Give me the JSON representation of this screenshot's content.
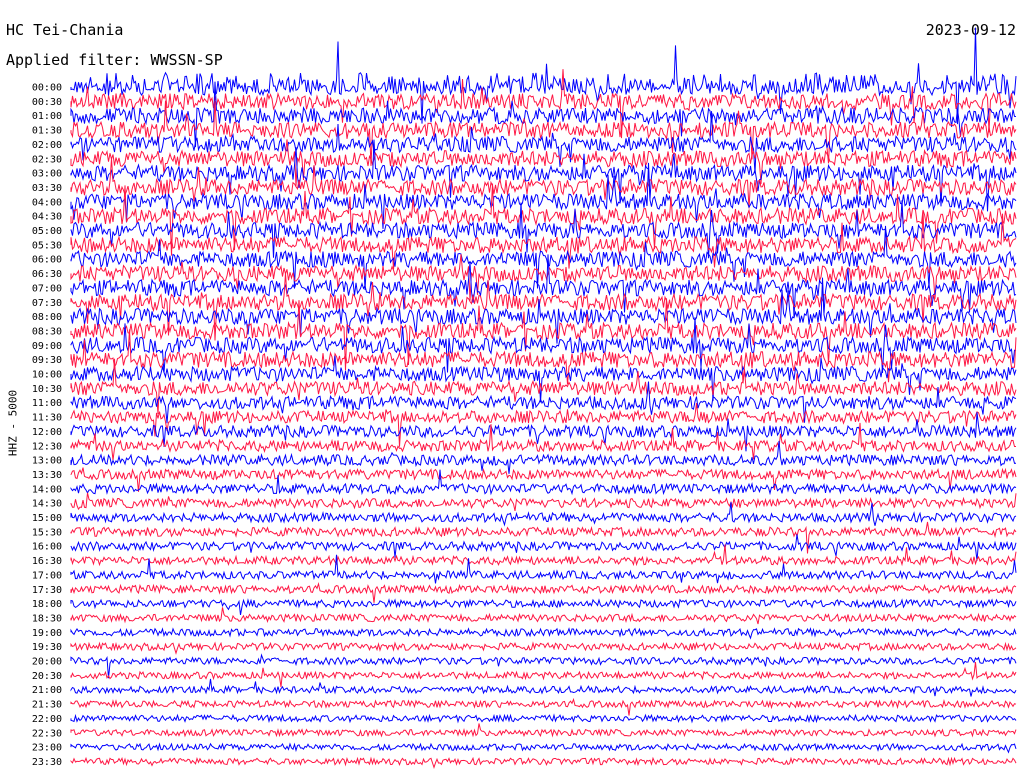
{
  "header": {
    "station": "HC Tei-Chania",
    "filter": "Applied filter: WWSSN-SP",
    "date": "2023-09-12",
    "channel": "HHZ - 5000"
  },
  "colors": {
    "trace_a": "#0000ff",
    "trace_b": "#ff1744",
    "background": "#ffffff"
  },
  "chart_data": {
    "type": "helicorder",
    "row_labels": [
      "00:00",
      "00:30",
      "01:00",
      "01:30",
      "02:00",
      "02:30",
      "03:00",
      "03:30",
      "04:00",
      "04:30",
      "05:00",
      "05:30",
      "06:00",
      "06:30",
      "07:00",
      "07:30",
      "08:00",
      "08:30",
      "09:00",
      "09:30",
      "10:00",
      "10:30",
      "11:00",
      "11:30",
      "12:00",
      "12:30",
      "13:00",
      "13:30",
      "14:00",
      "14:30",
      "15:00",
      "15:30",
      "16:00",
      "16:30",
      "17:00",
      "17:30",
      "18:00",
      "18:30",
      "19:00",
      "19:30",
      "20:00",
      "20:30",
      "21:00",
      "21:30",
      "22:00",
      "22:30",
      "23:00",
      "23:30"
    ],
    "trace_colors": [
      "#0000ff",
      "#ff1744"
    ],
    "relative_activity": [
      1.0,
      1.0,
      1.0,
      1.0,
      1.0,
      1.0,
      1.0,
      1.0,
      1.0,
      1.0,
      1.0,
      1.0,
      1.0,
      1.0,
      1.0,
      1.0,
      1.0,
      1.0,
      1.0,
      1.0,
      0.9,
      0.85,
      0.75,
      0.7,
      0.65,
      0.6,
      0.55,
      0.5,
      0.48,
      0.45,
      0.42,
      0.4,
      0.38,
      0.36,
      0.34,
      0.32,
      0.3,
      0.28,
      0.27,
      0.26,
      0.25,
      0.24,
      0.23,
      0.22,
      0.21,
      0.2,
      0.2,
      0.2
    ]
  }
}
